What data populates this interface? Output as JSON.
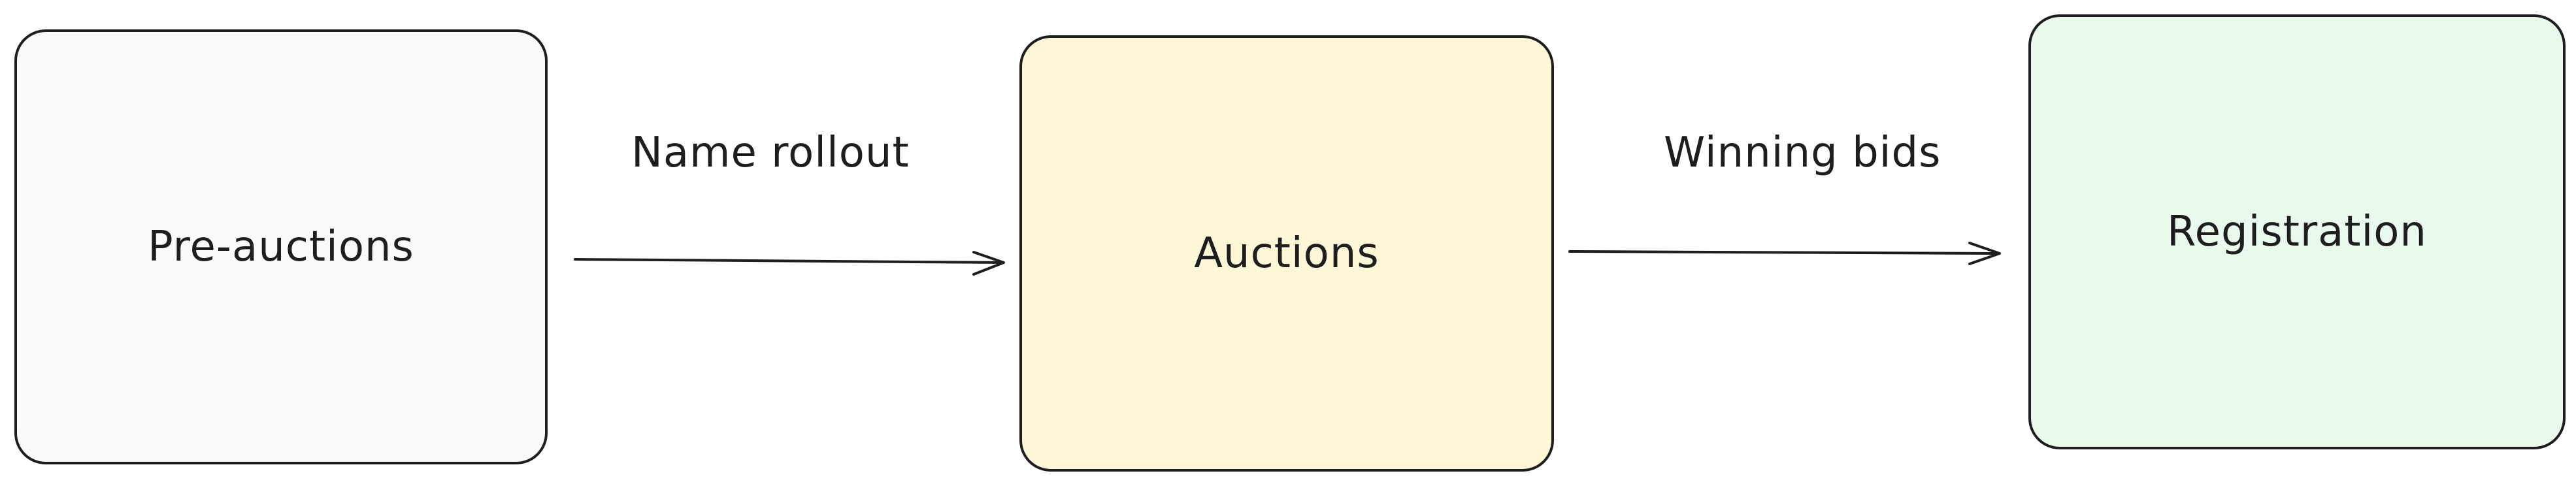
{
  "nodes": [
    {
      "label": "Pre-auctions",
      "fill": "#f8f9fa"
    },
    {
      "label": "Auctions",
      "fill": "#fdf7d8"
    },
    {
      "label": "Registration",
      "fill": "#e9f9ec"
    }
  ],
  "edges": [
    {
      "from": "Pre-auctions",
      "to": "Auctions",
      "label": "Name rollout"
    },
    {
      "from": "Auctions",
      "to": "Registration",
      "label": "Winning bids"
    }
  ],
  "colors": {
    "stroke": "#1e1e1e",
    "background": "#ffffff"
  }
}
